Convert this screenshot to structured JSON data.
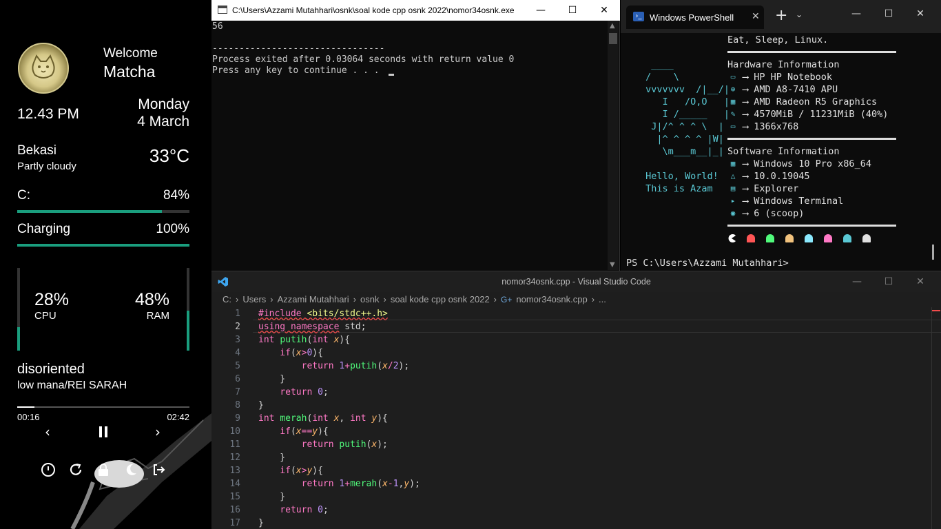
{
  "widget": {
    "welcome": "Welcome",
    "user": "Matcha",
    "time": "12.43 PM",
    "day": "Monday",
    "date": "4 March",
    "city": "Bekasi",
    "weather": "Partly cloudy",
    "temp": "33°C",
    "disk_label": "C:",
    "disk_pct": "84%",
    "disk_value": 0.84,
    "battery_label": "Charging",
    "battery_pct": "100%",
    "battery_value": 1.0,
    "cpu_pct": "28%",
    "cpu_label": "CPU",
    "cpu_value": 0.28,
    "ram_pct": "48%",
    "ram_label": "RAM",
    "ram_value": 0.48,
    "song_title": "disoriented",
    "song_artist": "low mana/REI SARAH",
    "elapsed": "00:16",
    "duration": "02:42",
    "progress_value": 0.1,
    "icons": [
      "prev-icon",
      "pause-icon",
      "next-icon",
      "power-icon",
      "restart-icon",
      "lock-icon",
      "sleep-icon",
      "logout-icon"
    ]
  },
  "console": {
    "title": "C:\\Users\\Azzami Mutahhari\\osnk\\soal kode cpp osnk 2022\\nomor34osnk.exe",
    "lines": [
      "56",
      "",
      "--------------------------------",
      "Process exited after 0.03064 seconds with return value 0",
      "Press any key to continue . . . "
    ]
  },
  "powershell": {
    "tab_title": "Windows PowerShell",
    "ascii": [
      "  ____",
      " /    \\",
      " vvvvvvv  /|__/|",
      "    I   /O,O   |",
      "    I /_____   |",
      "  J|/^ ^ ^ \\  |",
      "   |^ ^ ^ ^ |W|",
      "    \\m___m__|_|",
      "",
      " Hello, World!",
      " This is Azam"
    ],
    "tagline": "Eat, Sleep, Linux.",
    "hw_header": "Hardware Information",
    "hw": [
      {
        "icon": "laptop-icon",
        "text": "HP HP Notebook"
      },
      {
        "icon": "cpu-icon",
        "text": "AMD A8-7410 APU"
      },
      {
        "icon": "gpu-icon",
        "text": "AMD Radeon R5 Graphics"
      },
      {
        "icon": "memory-icon",
        "text": "4570MiB / 11231MiB (40%)"
      },
      {
        "icon": "monitor-icon",
        "text": "1366x768"
      }
    ],
    "sw_header": "Software Information",
    "sw": [
      {
        "icon": "windows-icon",
        "text": "Windows 10 Pro x86_64"
      },
      {
        "icon": "kernel-icon",
        "text": "10.0.19045"
      },
      {
        "icon": "explorer-icon",
        "text": "Explorer"
      },
      {
        "icon": "terminal-icon",
        "text": "Windows Terminal"
      },
      {
        "icon": "package-icon",
        "text": "6 (scoop)"
      }
    ],
    "arrow": "⟶",
    "prompt": "PS C:\\Users\\Azzami Mutahhari>",
    "ghost_colors": [
      "#ff5555",
      "#50fa7b",
      "#f1c27d",
      "#8be9fd",
      "#ff79c6",
      "#5ac8d4",
      "#e0e0e0"
    ]
  },
  "vscode": {
    "title": "nomor34osnk.cpp - Visual Studio Code",
    "breadcrumb": [
      "C:",
      "Users",
      "Azzami Mutahhari",
      "osnk",
      "soal kode cpp osnk 2022",
      "nomor34osnk.cpp",
      "..."
    ],
    "line_numbers": [
      "1",
      "2",
      "3",
      "4",
      "5",
      "6",
      "7",
      "8",
      "9",
      "10",
      "11",
      "12",
      "13",
      "14",
      "15",
      "16",
      "17"
    ]
  }
}
